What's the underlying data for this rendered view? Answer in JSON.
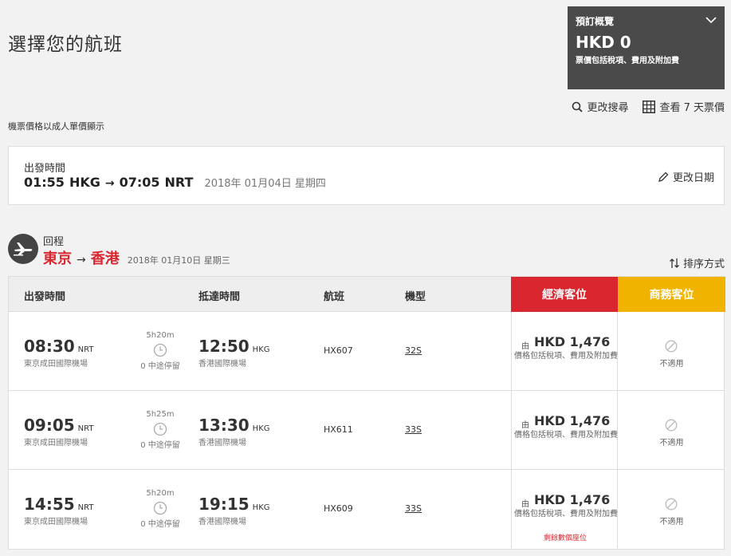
{
  "page": {
    "title": "選擇您的航班",
    "price_note": "機票價格以成人單價顯示"
  },
  "summary": {
    "title": "預訂概覽",
    "amount": "HKD 0",
    "note": "票價包括稅項、費用及附加費"
  },
  "actions": {
    "change_search": "更改搜尋",
    "view_7days": "查看 7 天票價"
  },
  "outbound": {
    "label": "出發時間",
    "dep_time": "01:55",
    "dep_code": "HKG",
    "arr_time": "07:05",
    "arr_code": "NRT",
    "date": "2018年 01月04日 星期四",
    "change_date": "更改日期"
  },
  "return": {
    "label": "回程",
    "from_city": "東京",
    "to_city": "香港",
    "date": "2018年 01月10日 星期三",
    "sort": "排序方式"
  },
  "table": {
    "headers": {
      "dep": "出發時間",
      "arr": "抵達時間",
      "flight": "航班",
      "aircraft": "機型",
      "economy": "經濟客位",
      "business": "商務客位"
    },
    "rows": [
      {
        "dep_time": "08:30",
        "dep_code": "NRT",
        "dep_airport": "東京成田國際機場",
        "duration": "5h20m",
        "stops": "0 中途停留",
        "arr_time": "12:50",
        "arr_code": "HKG",
        "arr_airport": "香港國際機場",
        "flight": "HX607",
        "aircraft": "32S",
        "eco_from": "由",
        "eco_price": "HKD 1,476",
        "eco_note": "價格包括稅項、費用及附加費",
        "eco_seats": "",
        "business": "不適用"
      },
      {
        "dep_time": "09:05",
        "dep_code": "NRT",
        "dep_airport": "東京成田國際機場",
        "duration": "5h25m",
        "stops": "0 中途停留",
        "arr_time": "13:30",
        "arr_code": "HKG",
        "arr_airport": "香港國際機場",
        "flight": "HX611",
        "aircraft": "33S",
        "eco_from": "由",
        "eco_price": "HKD 1,476",
        "eco_note": "價格包括稅項、費用及附加費",
        "eco_seats": "",
        "business": "不適用"
      },
      {
        "dep_time": "14:55",
        "dep_code": "NRT",
        "dep_airport": "東京成田國際機場",
        "duration": "5h20m",
        "stops": "0 中途停留",
        "arr_time": "19:15",
        "arr_code": "HKG",
        "arr_airport": "香港國際機場",
        "flight": "HX609",
        "aircraft": "33S",
        "eco_from": "由",
        "eco_price": "HKD 1,476",
        "eco_note": "價格包括稅項、費用及附加費",
        "eco_seats": "剩餘數個座位",
        "business": "不適用"
      }
    ]
  },
  "colors": {
    "economy": "#d9262f",
    "business": "#f0b400",
    "summary_bg": "#4a4a4a"
  },
  "icons": {
    "search": "search-icon",
    "calendar": "calendar-grid-icon",
    "edit": "pencil-icon",
    "plane": "plane-icon",
    "sort": "sort-icon",
    "clock": "clock-icon",
    "na": "not-available-icon",
    "chevron": "chevron-down-icon"
  }
}
